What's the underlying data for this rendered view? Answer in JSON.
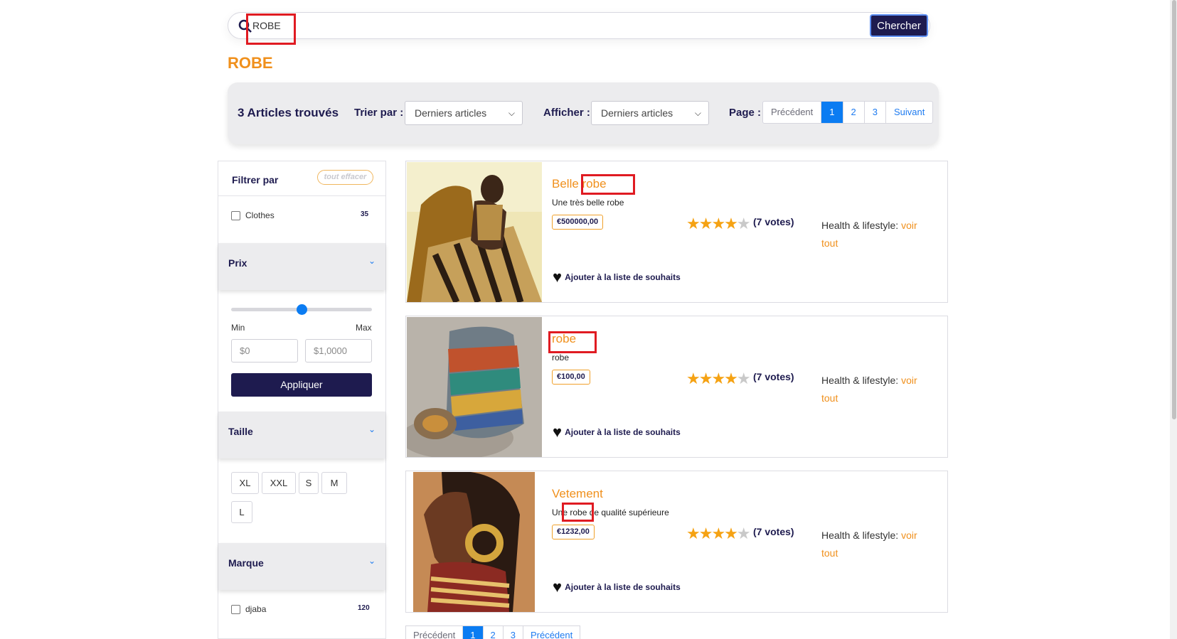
{
  "search": {
    "value": "ROBE",
    "button_label": "Chercher"
  },
  "result_title": "ROBE",
  "toolbar": {
    "count": "3 Articles trouvés",
    "sort_label": "Trier par :",
    "sort_value": "Derniers articles",
    "show_label": "Afficher :",
    "show_value": "Derniers articles",
    "page_label": "Page :",
    "pager": {
      "prev": "Précédent",
      "pages": [
        "1",
        "2",
        "3"
      ],
      "next": "Suivant",
      "active": "1"
    }
  },
  "sidebar": {
    "filter_title": "Filtrer par",
    "clear_label": "tout effacer",
    "category": {
      "label": "Clothes",
      "count": "35"
    },
    "price": {
      "title": "Prix",
      "level": 0.5,
      "min_label": "Min",
      "max_label": "Max",
      "min_placeholder": "$0",
      "max_placeholder": "$1,0000",
      "apply_label": "Appliquer"
    },
    "size": {
      "title": "Taille",
      "options": [
        "XL",
        "XXL",
        "S",
        "M",
        "L"
      ]
    },
    "brand": {
      "title": "Marque",
      "item": {
        "label": "djaba",
        "count": "120"
      }
    }
  },
  "products": [
    {
      "name": "Belle robe",
      "description": "Une très belle robe",
      "price": "€500000,00",
      "rating": 4,
      "votes": "(7 votes)",
      "category_label": "Health & lifestyle:",
      "category_link": "voir tout",
      "wishlist": "Ajouter à la liste de souhaits"
    },
    {
      "name": "robe",
      "description": "robe",
      "price": "€100,00",
      "rating": 4,
      "votes": "(7 votes)",
      "category_label": "Health & lifestyle:",
      "category_link": "voir tout",
      "wishlist": "Ajouter à la liste de souhaits"
    },
    {
      "name": "Vetement",
      "description": "Une robe de qualité supérieure",
      "price": "€1232,00",
      "rating": 4,
      "votes": "(7 votes)",
      "category_label": "Health & lifestyle:",
      "category_link": "voir tout",
      "wishlist": "Ajouter à la liste de souhaits"
    }
  ],
  "bottom_pager": {
    "prev": "Précédent",
    "pages": [
      "1",
      "2",
      "3"
    ],
    "next": "Précédent",
    "active": "1"
  },
  "colors": {
    "accent": "#f0901c",
    "navy": "#1e1b4f",
    "active_page": "#0b7cf2",
    "highlight": "#e01b22"
  }
}
